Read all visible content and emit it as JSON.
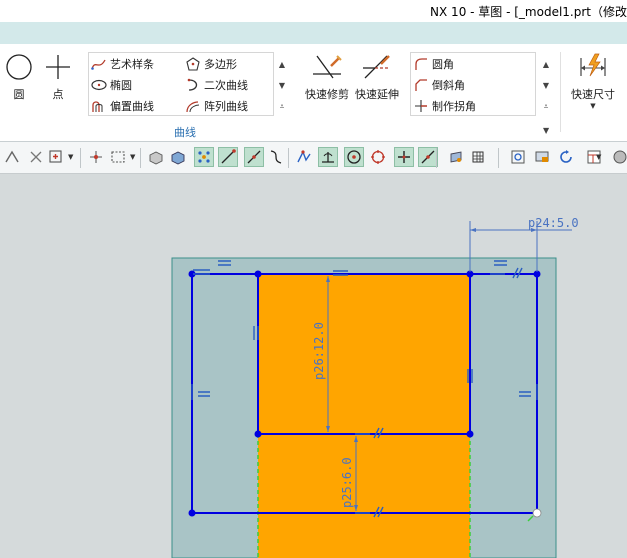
{
  "window": {
    "title": "NX 10 - 草图 - [_model1.prt（修改"
  },
  "ribbon": {
    "circle_label": "圆",
    "point_label": "点",
    "curves_left": [
      "艺术样条",
      "椭圆",
      "偏置曲线"
    ],
    "curves_right": [
      "多边形",
      "二次曲线",
      "阵列曲线"
    ],
    "trim_label": "快速修剪",
    "extend_label": "快速延伸",
    "edit_items": [
      "圆角",
      "倒斜角",
      "制作拐角"
    ],
    "dimension_label": "快速尺寸",
    "group_label": "曲线"
  },
  "toolbar": {
    "icons": [
      "sketch-icon",
      "snap-icon",
      "select-filter-icon",
      "point-filter-icon",
      "select-box-icon",
      "shaded-icon",
      "solid-icon",
      "snap-grid-icon",
      "line-icon",
      "curve-icon",
      "spline-icon",
      "intersect-icon",
      "perpendicular-icon",
      "center-icon",
      "quadrant-icon",
      "point-on-icon",
      "tangent-icon",
      "view-icon",
      "material-icon",
      "view-fit-icon",
      "display-icon",
      "refresh-icon",
      "layout-icon",
      "render-icon"
    ]
  },
  "sketch": {
    "dims": [
      {
        "label": "p24:5.0"
      },
      {
        "label": "p26:12.0"
      },
      {
        "label": "p25:6.0"
      }
    ]
  },
  "colors": {
    "sketch_line": "#0000e0",
    "fill": "#ffa500",
    "sheet": "#a9c4c6",
    "dimension": "#4a73c2",
    "ribbon_top": "#d3e9ea"
  }
}
